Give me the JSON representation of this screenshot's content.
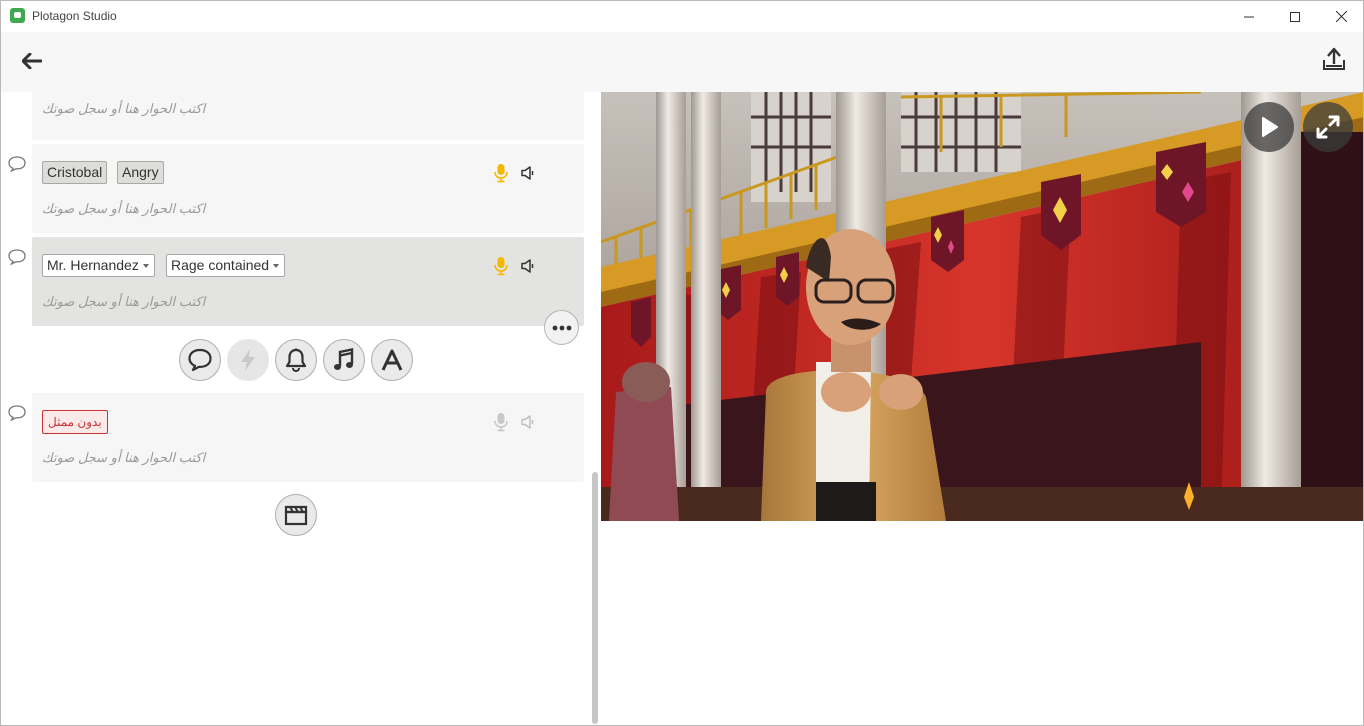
{
  "window": {
    "title": "Plotagon Studio"
  },
  "script": {
    "placeholder": "اكتب الحوار هنا أو سجل صوتك",
    "lines": [
      {
        "character": "Cristobal",
        "emotion": "Angry"
      },
      {
        "character": "Mr. Hernandez",
        "emotion": "Rage contained"
      },
      {
        "no_actor_label": "بدون ممثل"
      }
    ]
  },
  "colors": {
    "mic_active": "#f5b800",
    "mic_inactive": "#c8c8c8",
    "no_actor": "#cc3333",
    "active_card": "#e3e3e1"
  },
  "icons": {
    "add_toolbar": [
      "speech-bubble-icon",
      "lightning-icon",
      "bell-icon",
      "music-note-icon",
      "text-letter-icon"
    ],
    "scene": "clapperboard-icon"
  }
}
